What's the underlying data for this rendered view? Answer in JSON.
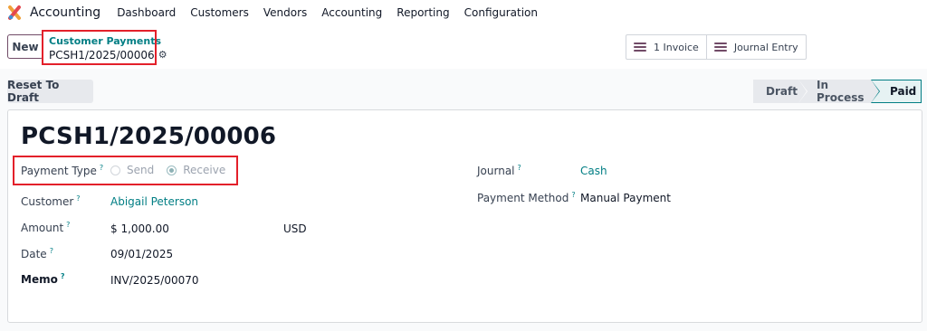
{
  "app": {
    "name": "Accounting",
    "logo_icon": "odoo-accounting-logo-icon"
  },
  "nav": {
    "items": [
      "Dashboard",
      "Customers",
      "Vendors",
      "Accounting",
      "Reporting",
      "Configuration"
    ]
  },
  "control": {
    "new_label": "New",
    "breadcrumb_parent": "Customer Payments",
    "breadcrumb_current": "PCSH1/2025/00006",
    "gear_icon": "gear-icon",
    "smart_buttons": [
      {
        "label": "1 Invoice",
        "icon": "list-icon"
      },
      {
        "label": "Journal Entry",
        "icon": "list-icon"
      }
    ]
  },
  "status": {
    "reset_label": "Reset To Draft",
    "stages": [
      "Draft",
      "In Process",
      "Paid"
    ],
    "current_stage": "Paid"
  },
  "form": {
    "title": "PCSH1/2025/00006",
    "payment_type": {
      "label": "Payment Type",
      "options": [
        "Send",
        "Receive"
      ],
      "selected": "Receive"
    },
    "customer": {
      "label": "Customer",
      "value": "Abigail Peterson"
    },
    "amount": {
      "label": "Amount",
      "value": "$ 1,000.00",
      "currency": "USD"
    },
    "date": {
      "label": "Date",
      "value": "09/01/2025"
    },
    "memo": {
      "label": "Memo",
      "value": "INV/2025/00070"
    },
    "journal": {
      "label": "Journal",
      "value": "Cash"
    },
    "payment_method": {
      "label": "Payment Method",
      "value": "Manual Payment"
    },
    "tooltip_marker": "?"
  },
  "colors": {
    "brand": "#714b67",
    "link": "#017e84",
    "highlight": "#e3202a"
  }
}
